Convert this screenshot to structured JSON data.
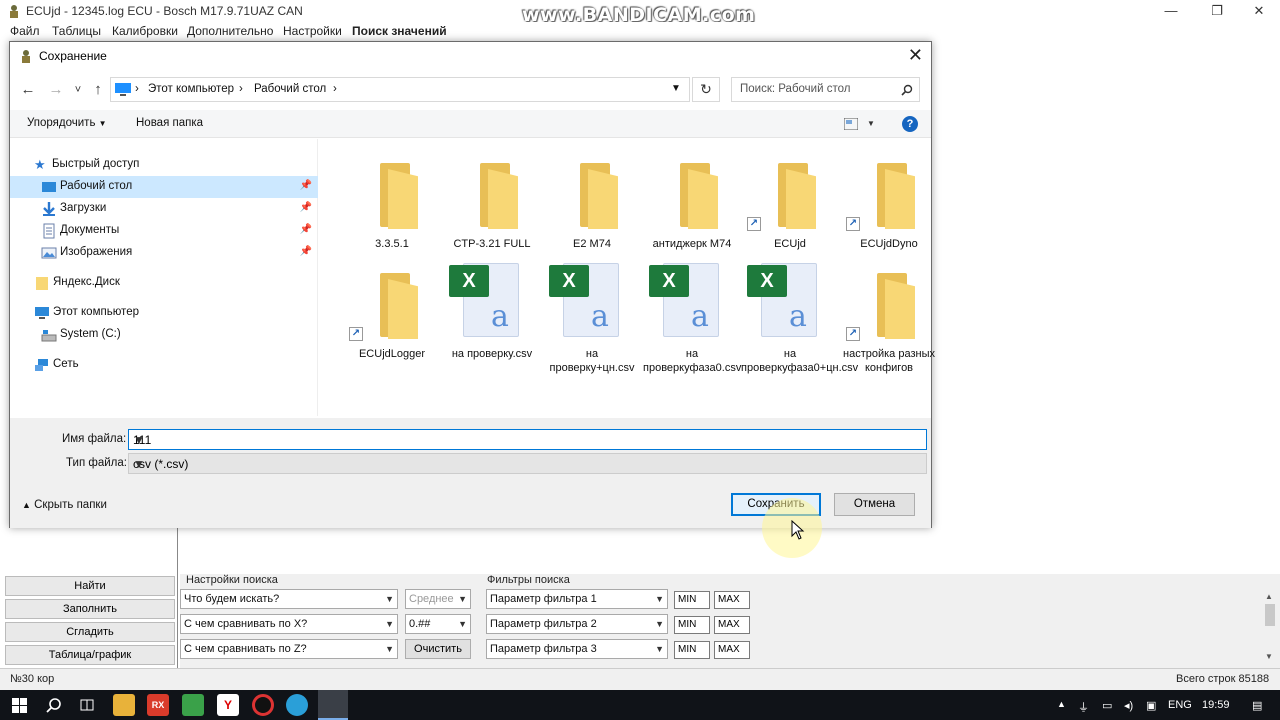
{
  "window": {
    "title": "ECUjd - 12345.log ECU - Bosch M17.9.71UAZ CAN",
    "watermark": "www.BANDICAM.com",
    "controls": {
      "minimize": "—",
      "maximize": "❐",
      "close": "✕"
    }
  },
  "menu": [
    "Файл",
    "Таблицы",
    "Калибровки",
    "Дополнительно",
    "Настройки",
    "Поиск значений"
  ],
  "dialog": {
    "title": "Сохранение",
    "close": "✕",
    "nav": {
      "back": "←",
      "forward": "→",
      "recent": "˅",
      "up": "↑",
      "refresh": "↻"
    },
    "breadcrumb": [
      "Этот компьютер",
      "Рабочий стол"
    ],
    "breadcrumb_sep": "›",
    "search_placeholder": "Поиск: Рабочий стол",
    "toolbar": {
      "organize": "Упорядочить",
      "new_folder": "Новая папка",
      "help": "?"
    },
    "nav_pane": [
      {
        "label": "Быстрый доступ",
        "icon": "star-icon"
      },
      {
        "label": "Рабочий стол",
        "icon": "desktop-icon",
        "pinned": true,
        "selected": true
      },
      {
        "label": "Загрузки",
        "icon": "download-icon",
        "pinned": true
      },
      {
        "label": "Документы",
        "icon": "documents-icon",
        "pinned": true
      },
      {
        "label": "Изображения",
        "icon": "pictures-icon",
        "pinned": true
      },
      {
        "label": "Яндекс.Диск",
        "icon": "folder-icon"
      },
      {
        "label": "Этот компьютер",
        "icon": "computer-icon"
      },
      {
        "label": "System (C:)",
        "icon": "drive-icon"
      },
      {
        "label": "Сеть",
        "icon": "network-icon"
      }
    ],
    "files": [
      {
        "name": "3.3.5.1",
        "type": "folder"
      },
      {
        "name": "CTP-3.21 FULL",
        "type": "folder"
      },
      {
        "name": "E2 M74",
        "type": "folder"
      },
      {
        "name": "антиджерк M74",
        "type": "folder"
      },
      {
        "name": "ECUjd",
        "type": "folder-shortcut"
      },
      {
        "name": "ECUjdDyno",
        "type": "folder-shortcut"
      },
      {
        "name": "ECUjdLogger",
        "type": "folder-shortcut"
      },
      {
        "name": "на проверку.csv",
        "type": "csv"
      },
      {
        "name": "на проверку+цн.csv",
        "type": "csv"
      },
      {
        "name": "на проверкуфаза0.csv",
        "type": "csv"
      },
      {
        "name": "на проверкуфаза0+цн.csv",
        "type": "csv"
      },
      {
        "name": "настройка разных конфигов",
        "type": "folder-shortcut"
      }
    ],
    "filename_label": "Имя файла:",
    "filename_value": "111",
    "filetype_label": "Тип файла:",
    "filetype_value": "csv (*.csv)",
    "hide_folders": "Скрыть папки",
    "save": "Сохранить",
    "cancel": "Отмена"
  },
  "left_buttons": [
    "Найти",
    "Заполнить",
    "Сгладить",
    "Таблица/график"
  ],
  "search_settings": {
    "title": "Настройки поиска",
    "what": "Что будем искать?",
    "mode": "Среднее",
    "compare_x": "С чем сравнивать по X?",
    "format": "0.##",
    "compare_z": "С чем сравнивать по Z?",
    "clear": "Очистить"
  },
  "filters": {
    "title": "Фильтры поиска",
    "items": [
      {
        "param": "Параметр фильтра 1",
        "min": "MIN",
        "max": "MAX"
      },
      {
        "param": "Параметр фильтра 2",
        "min": "MIN",
        "max": "MAX"
      },
      {
        "param": "Параметр фильтра 3",
        "min": "MIN",
        "max": "MAX"
      }
    ]
  },
  "status": {
    "left": "№30 кор",
    "right": "Всего строк 85188"
  },
  "taskbar": {
    "lang": "ENG",
    "time": "19:59",
    "apps": [
      "start-icon",
      "search-icon",
      "task-view-icon",
      "explorer-icon",
      "rx-icon",
      "green-app-icon",
      "yandex-browser-icon",
      "record-icon",
      "telegram-icon",
      "ecujd-icon"
    ]
  }
}
